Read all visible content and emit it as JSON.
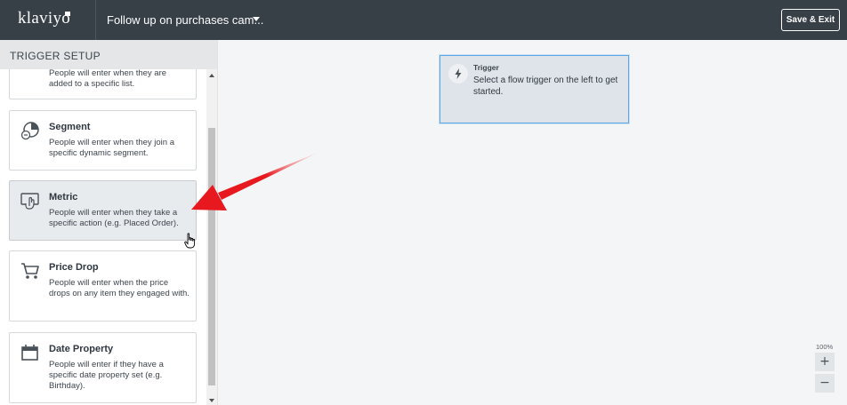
{
  "header": {
    "logo": "klaviyo",
    "campaign_title": "Follow up on purchases cam...",
    "save_exit": "Save & Exit"
  },
  "sidebar": {
    "title": "TRIGGER SETUP",
    "cards": [
      {
        "title": "",
        "desc": "People will enter when they are added to a specific list.",
        "icon": "list-icon"
      },
      {
        "title": "Segment",
        "desc": "People will enter when they join a specific dynamic segment.",
        "icon": "segment-icon"
      },
      {
        "title": "Metric",
        "desc": "People will enter when they take a specific action (e.g. Placed Order).",
        "icon": "metric-icon"
      },
      {
        "title": "Price Drop",
        "desc": "People will enter when the price drops on any item they engaged with.",
        "icon": "cart-icon"
      },
      {
        "title": "Date Property",
        "desc": "People will enter if they have a specific date property set (e.g. Birthday).",
        "icon": "calendar-icon"
      }
    ]
  },
  "canvas": {
    "trigger": {
      "label": "Trigger",
      "desc": "Select a flow trigger on the left to get started."
    },
    "zoom": {
      "level": "100%",
      "plus": "+",
      "minus": "−"
    }
  },
  "colors": {
    "topbar": "#373f47",
    "trigger_border": "#5ba7e5",
    "arrow": "#e8191e"
  }
}
